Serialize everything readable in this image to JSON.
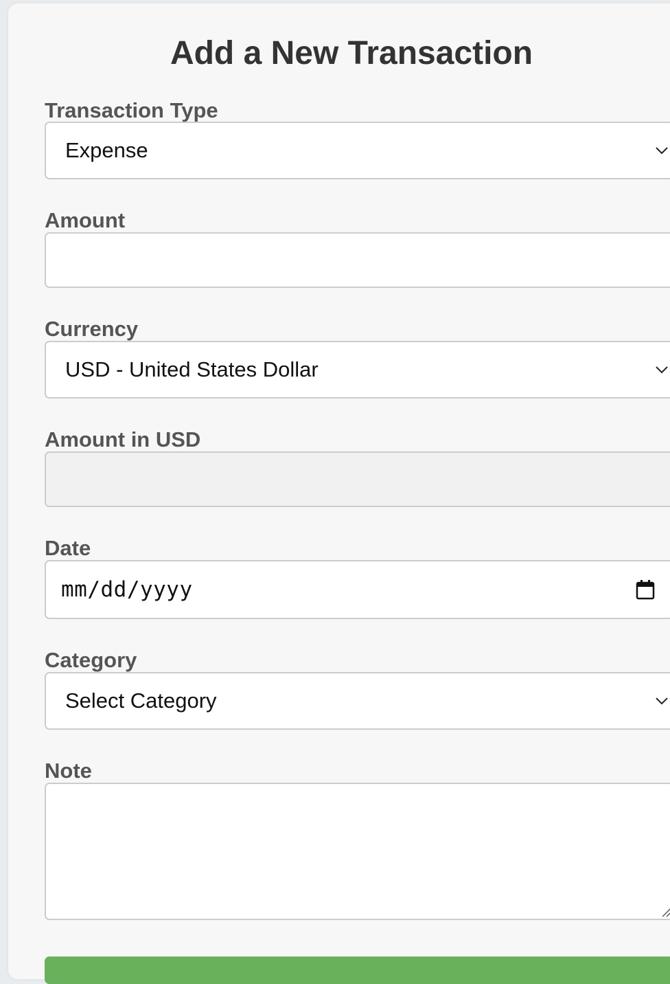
{
  "form": {
    "title": "Add a New Transaction",
    "transaction_type": {
      "label": "Transaction Type",
      "value": "Expense"
    },
    "amount": {
      "label": "Amount",
      "value": ""
    },
    "currency": {
      "label": "Currency",
      "value": "USD - United States Dollar"
    },
    "amount_usd": {
      "label": "Amount in USD",
      "value": ""
    },
    "date": {
      "label": "Date",
      "placeholder": "mm/dd/yyyy"
    },
    "category": {
      "label": "Category",
      "value": "Select Category"
    },
    "note": {
      "label": "Note",
      "value": ""
    }
  },
  "icons": {
    "select_arrow": "chevron-down-icon",
    "date_picker": "calendar-icon",
    "textarea_resize": "resize-handle-icon"
  },
  "colors": {
    "submit_button": "#6ab15b",
    "label_text": "#555555",
    "title_text": "#333333"
  }
}
